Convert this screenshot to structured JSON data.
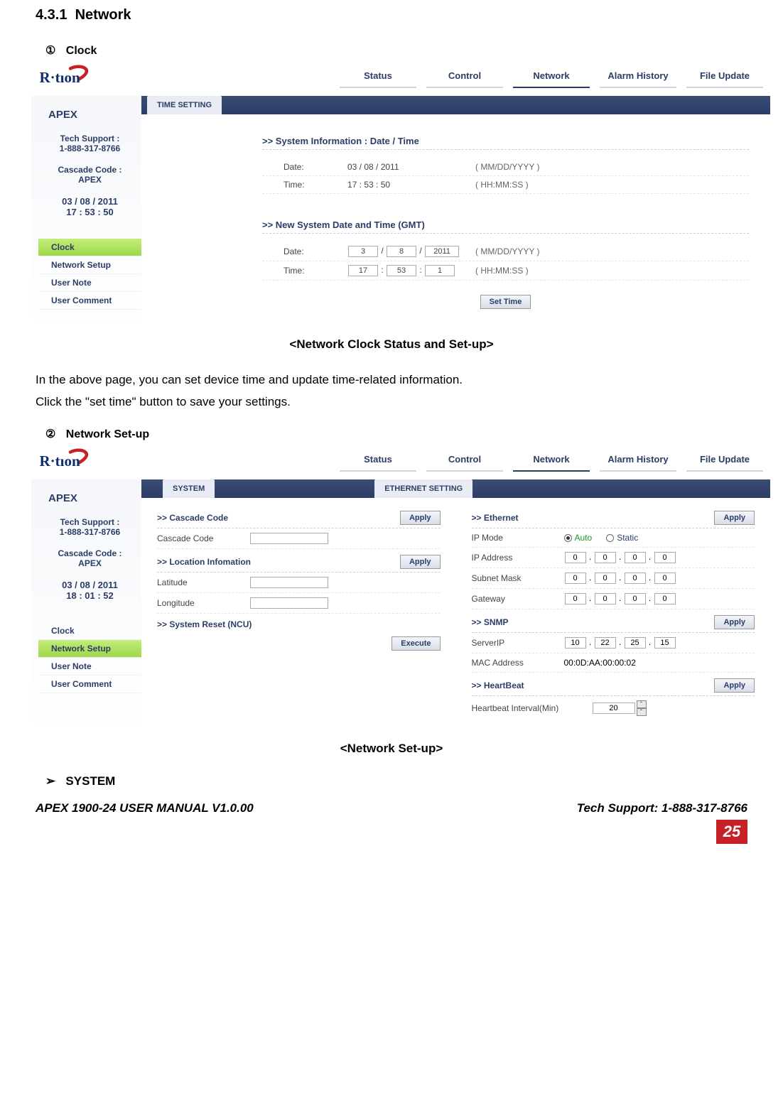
{
  "section_number": "4.3.1",
  "section_title": "Network",
  "item1_marker": "①",
  "item1_title": "Clock",
  "item2_marker": "②",
  "item2_title": "Network Set-up",
  "caption1": "<Network Clock Status and Set-up>",
  "caption2": "<Network Set-up>",
  "body_para1": "In the above page, you can set device time and update time-related information.",
  "body_para2": "Click the \"set time\" button to save your settings.",
  "chevron_label": "SYSTEM",
  "footer_left": "APEX 1900-24 USER MANUAL V1.0.00",
  "footer_right": "Tech Support: 1-888-317-8766",
  "page_number": "25",
  "topnav": [
    "Status",
    "Control",
    "Network",
    "Alarm History",
    "File Update"
  ],
  "topnav_active_index": 2,
  "sidebar": {
    "title": "APEX",
    "tech_label": "Tech Support :",
    "tech_phone": "1-888-317-8766",
    "cascade_label": "Cascade Code :",
    "cascade_value": "APEX"
  },
  "shot1": {
    "date": "03 / 08 / 2011",
    "time": "17 : 53 : 50",
    "menu": [
      "Clock",
      "Network Setup",
      "User Note",
      "User Comment"
    ],
    "menu_active_index": 0,
    "tab_label": "TIME SETTING",
    "section_a": ">> System Information : Date / Time",
    "date_label": "Date:",
    "date_value": "03 / 08 / 2011",
    "date_hint": "( MM/DD/YYYY )",
    "time_label": "Time:",
    "time_value": "17 : 53 : 50",
    "time_hint": "( HH:MM:SS )",
    "section_b": ">> New System Date and Time (GMT)",
    "new_date_m": "3",
    "new_date_d": "8",
    "new_date_y": "2011",
    "new_time_h": "17",
    "new_time_m": "53",
    "new_time_s": "1",
    "set_time_btn": "Set Time"
  },
  "shot2": {
    "date": "03 / 08 / 2011",
    "time": "18 : 01 : 52",
    "menu": [
      "Clock",
      "Network Setup",
      "User Note",
      "User Comment"
    ],
    "menu_active_index": 1,
    "tab_system": "SYSTEM",
    "tab_ethernet": "ETHERNET SETTING",
    "apply_btn": "Apply",
    "execute_btn": "Execute",
    "s_cascade_head": ">> Cascade Code",
    "s_cascade_label": "Cascade Code",
    "s_location_head": ">> Location Infomation",
    "s_lat_label": "Latitude",
    "s_lon_label": "Longitude",
    "s_reset_head": ">> System Reset (NCU)",
    "e_ethernet_head": ">> Ethernet",
    "e_ipmode_label": "IP Mode",
    "e_ipmode_auto": "Auto",
    "e_ipmode_static": "Static",
    "e_ipaddr_label": "IP Address",
    "e_subnet_label": "Subnet Mask",
    "e_gateway_label": "Gateway",
    "ip_zero": "0",
    "e_snmp_head": ">> SNMP",
    "e_serverip_label": "ServerIP",
    "serverip": [
      "10",
      "22",
      "25",
      "15"
    ],
    "e_mac_label": "MAC Address",
    "e_mac_value": "00:0D:AA:00:00:02",
    "e_heartbeat_head": ">> HeartBeat",
    "e_hb_label": "Heartbeat Interval(Min)",
    "e_hb_value": "20"
  }
}
